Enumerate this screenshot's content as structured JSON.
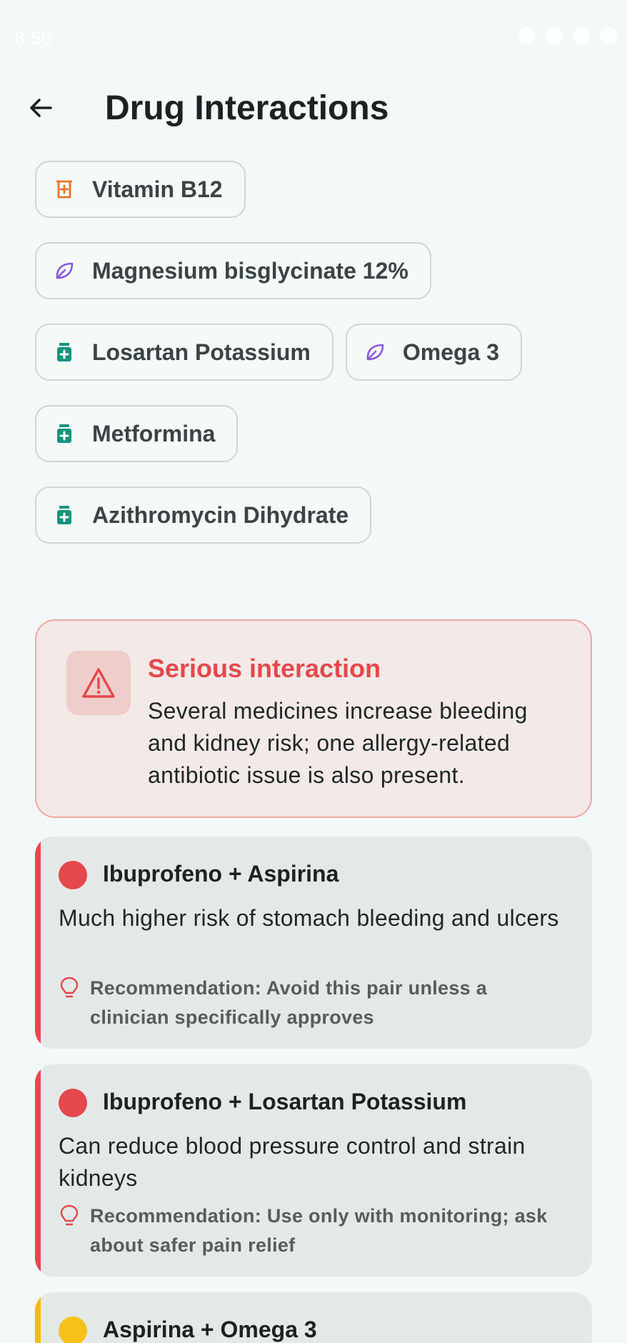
{
  "status_bar": {
    "time": "8:50"
  },
  "app_bar": {
    "title": "Drug Interactions"
  },
  "chips": [
    {
      "label": "Vitamin B12",
      "icon": "vitamin-icon",
      "color": "#e8742a"
    },
    {
      "label": "Magnesium bisglycinate 12%",
      "icon": "leaf-icon",
      "color": "#8a5ad8"
    },
    {
      "label": "Losartan Potassium",
      "icon": "medicine-bottle-icon",
      "color": "#13937f"
    },
    {
      "label": "Omega 3",
      "icon": "leaf-icon",
      "color": "#8a5ad8"
    },
    {
      "label": "Metformina",
      "icon": "medicine-bottle-icon",
      "color": "#13937f"
    },
    {
      "label": "Azithromycin Dihydrate",
      "icon": "medicine-bottle-icon",
      "color": "#13937f"
    }
  ],
  "summary": {
    "title": "Serious interaction",
    "text": "Several medicines increase bleeding and kidney risk; one allergy-related antibiotic issue is also present.",
    "icon": "warning-triangle-icon",
    "color": "#e5484d"
  },
  "interactions": [
    {
      "pair": "Ibuprofeno + Aspirina",
      "severity_color": "#e5484d",
      "description": "Much higher risk of stomach bleeding and ulcers",
      "recommendation": "Recommendation: Avoid this pair unless a clinician specifically approves"
    },
    {
      "pair": "Ibuprofeno + Losartan Potassium",
      "severity_color": "#e5484d",
      "description": "Can reduce blood pressure control and strain kidneys",
      "recommendation": "Recommendation: Use only with monitoring; ask about safer pain relief"
    },
    {
      "pair": "Aspirina + Omega 3",
      "severity_color": "#f6b81a",
      "description": "",
      "recommendation": ""
    }
  ]
}
